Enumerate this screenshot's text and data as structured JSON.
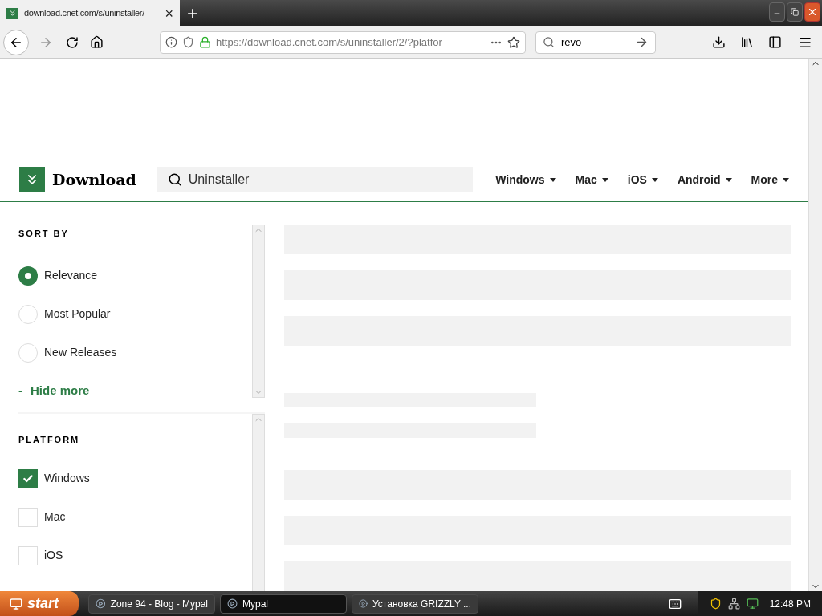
{
  "browser": {
    "tab": {
      "title": "download.cnet.com/s/uninstaller/",
      "close": "×"
    },
    "new_tab": "+",
    "url": "https://download.cnet.com/s/uninstaller/2/?platfor",
    "search": "revo"
  },
  "site": {
    "logo": "Download",
    "search": "Uninstaller",
    "nav": [
      {
        "label": "Windows"
      },
      {
        "label": "Mac"
      },
      {
        "label": "iOS"
      },
      {
        "label": "Android"
      },
      {
        "label": "More"
      }
    ]
  },
  "sort": {
    "title": "SORT BY",
    "options": [
      {
        "label": "Relevance",
        "selected": true
      },
      {
        "label": "Most Popular",
        "selected": false
      },
      {
        "label": "New Releases",
        "selected": false
      }
    ],
    "toggle": {
      "symbol": "-",
      "label": "Hide more"
    }
  },
  "platform": {
    "title": "PLATFORM",
    "options": [
      {
        "label": "Windows",
        "checked": true
      },
      {
        "label": "Mac",
        "checked": false
      },
      {
        "label": "iOS",
        "checked": false
      }
    ]
  },
  "taskbar": {
    "start": "start",
    "tasks": [
      {
        "label": "Zone 94 - Blog - Mypal",
        "selected": false
      },
      {
        "label": "Mypal",
        "selected": true
      },
      {
        "label": "Установка GRIZZLY ...",
        "selected": false
      }
    ],
    "clock": "12:48 PM"
  }
}
